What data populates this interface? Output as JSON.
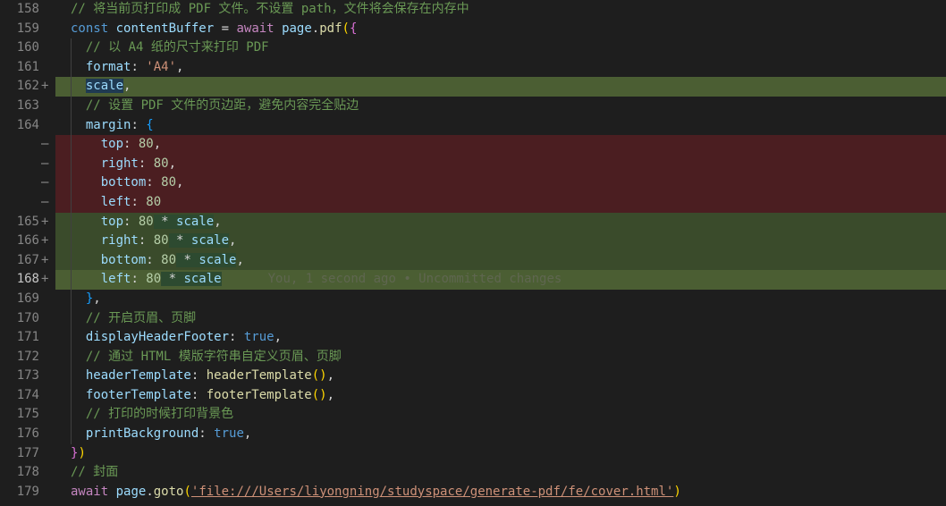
{
  "editor": {
    "lines": [
      {
        "num": "158",
        "marker": "",
        "kind": "normal"
      },
      {
        "num": "159",
        "marker": "",
        "kind": "normal"
      },
      {
        "num": "160",
        "marker": "",
        "kind": "normal"
      },
      {
        "num": "161",
        "marker": "",
        "kind": "normal"
      },
      {
        "num": "162",
        "marker": "+",
        "kind": "added"
      },
      {
        "num": "163",
        "marker": "",
        "kind": "normal"
      },
      {
        "num": "164",
        "marker": "",
        "kind": "normal"
      },
      {
        "num": "",
        "marker": "—",
        "kind": "removed"
      },
      {
        "num": "",
        "marker": "—",
        "kind": "removed"
      },
      {
        "num": "",
        "marker": "—",
        "kind": "removed"
      },
      {
        "num": "",
        "marker": "—",
        "kind": "removed"
      },
      {
        "num": "165",
        "marker": "+",
        "kind": "added"
      },
      {
        "num": "166",
        "marker": "+",
        "kind": "added"
      },
      {
        "num": "167",
        "marker": "+",
        "kind": "added"
      },
      {
        "num": "168",
        "marker": "+",
        "kind": "added"
      },
      {
        "num": "169",
        "marker": "",
        "kind": "normal"
      },
      {
        "num": "170",
        "marker": "",
        "kind": "normal"
      },
      {
        "num": "171",
        "marker": "",
        "kind": "normal"
      },
      {
        "num": "172",
        "marker": "",
        "kind": "normal"
      },
      {
        "num": "173",
        "marker": "",
        "kind": "normal"
      },
      {
        "num": "174",
        "marker": "",
        "kind": "normal"
      },
      {
        "num": "175",
        "marker": "",
        "kind": "normal"
      },
      {
        "num": "176",
        "marker": "",
        "kind": "normal"
      },
      {
        "num": "177",
        "marker": "",
        "kind": "normal"
      },
      {
        "num": "178",
        "marker": "",
        "kind": "normal"
      },
      {
        "num": "179",
        "marker": "",
        "kind": "normal"
      }
    ],
    "code": {
      "l158_comment": "// 将当前页打印成 PDF 文件。不设置 path，文件将会保存在内存中",
      "l159_const": "const",
      "l159_var": "contentBuffer",
      "l159_eq": " = ",
      "l159_await": "await",
      "l159_page": "page",
      "l159_pdf": "pdf",
      "l160_comment": "// 以 A4 纸的尺寸来打印 PDF",
      "l161_key": "format",
      "l161_val": "'A4'",
      "l162_key": "scale",
      "l163_comment": "// 设置 PDF 文件的页边距，避免内容完全贴边",
      "l164_key": "margin",
      "r1_key": "top",
      "r1_val": "80",
      "r2_key": "right",
      "r2_val": "80",
      "r3_key": "bottom",
      "r3_val": "80",
      "r4_key": "left",
      "r4_val": "80",
      "a1_key": "top",
      "a1_num": "80",
      "a1_scale": "scale",
      "a2_key": "right",
      "a2_num": "80",
      "a2_scale": "scale",
      "a3_key": "bottom",
      "a3_num": "80",
      "a3_scale": "scale",
      "a4_key": "left",
      "a4_num": "80",
      "a4_scale": "scale",
      "blame": "You, 1 second ago • Uncommitted changes",
      "l170_comment": "// 开启页眉、页脚",
      "l171_key": "displayHeaderFooter",
      "l171_val": "true",
      "l172_comment": "// 通过 HTML 模版字符串自定义页眉、页脚",
      "l173_key": "headerTemplate",
      "l173_fn": "headerTemplate",
      "l174_key": "footerTemplate",
      "l174_fn": "footerTemplate",
      "l175_comment": "// 打印的时候打印背景色",
      "l176_key": "printBackground",
      "l176_val": "true",
      "l178_comment": "// 封面",
      "l179_await": "await",
      "l179_page": "page",
      "l179_goto": "goto",
      "l179_url": "'file:///Users/liyongning/studyspace/generate-pdf/fe/cover.html'"
    }
  }
}
